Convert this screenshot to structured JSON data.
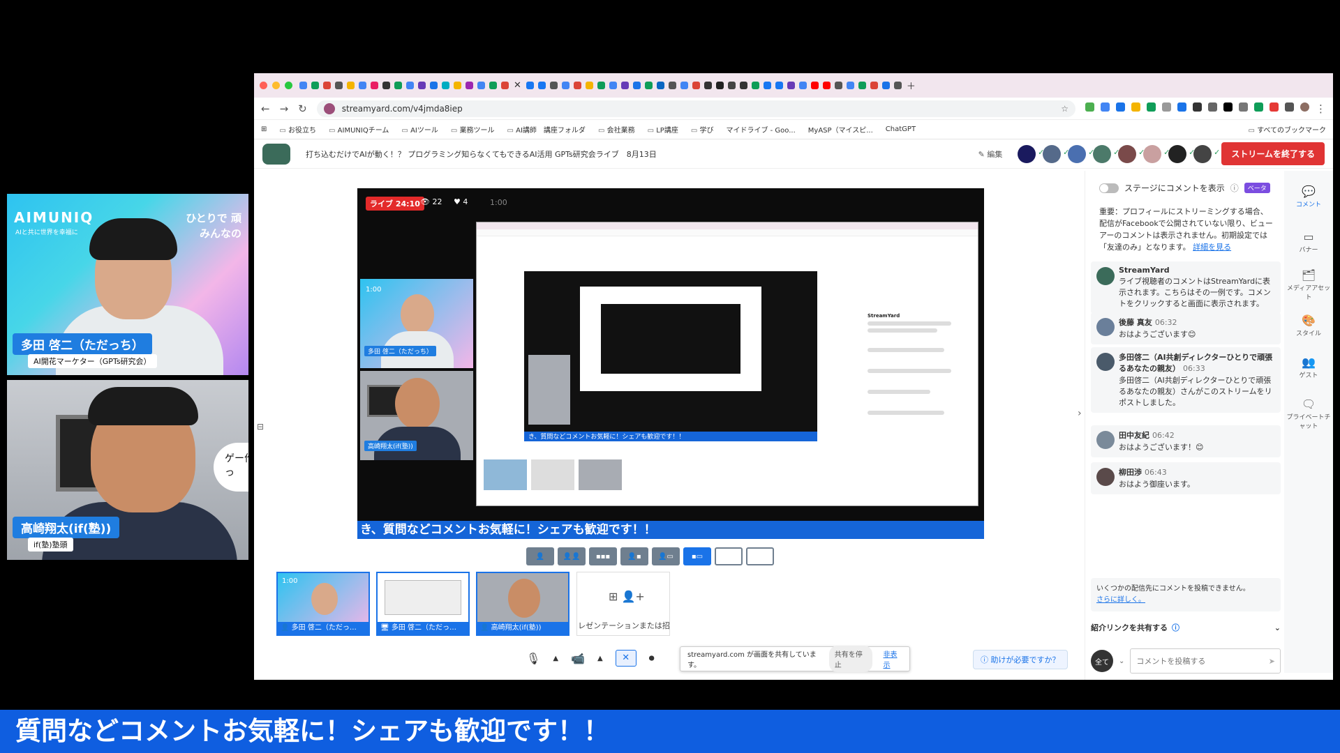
{
  "left_cams": {
    "cam1": {
      "logo": "AIMUNIQ",
      "logo_sub": "AIと共に世界を幸福に",
      "side_text_1": "ひとりで 頑",
      "side_text_2": "みんなの",
      "name": "多田 啓二（ただっち）",
      "title": "AI開花マーケター（GPTs研究会）"
    },
    "cam2": {
      "bubble": "ゲー作っ",
      "name": "高崎翔太(if(塾))",
      "title": "if(塾)塾頭"
    }
  },
  "browser": {
    "url": "streamyard.com/v4jmda8iep",
    "bookmarks": [
      "お役立ち",
      "AIMUNIQチーム",
      "AIツール",
      "業務ツール",
      "AI講師　講座フォルダ",
      "会社業務",
      "LP講座",
      "学び",
      "マイドライブ - Goo...",
      "MyASP（マイスピ...",
      "ChatGPT"
    ],
    "bookmarks_right": "すべてのブックマーク"
  },
  "streamyard": {
    "title": "打ち込むだけでAIが動く！？ プログラミング知らなくてもできるAI活用 GPTs研究会ライブ　8月13日",
    "edit_label": "編集",
    "end_stream": "ストリームを終了する",
    "live_badge": "ライブ 24:10",
    "viewers": "22",
    "reactions": "4",
    "stage_timer": "1:00",
    "stage_banner": "き、質問などコメントお気軽に！シェアも歓迎です！！",
    "inner_banner": "き、質問などコメントお気軽に！シェアも歓迎です！！",
    "inner_chat_name": "StreamYard",
    "mini_cam_1": "多田 啓二（ただっち）",
    "mini_cam_2": "高崎翔太(if(塾))",
    "mini_timer": "1:00",
    "thumbs": [
      "多田 啓二（ただっ…",
      "多田 啓二（ただっ…",
      "高崎翔太(if(塾))"
    ],
    "thumb_timer": "1:00",
    "add_label": "レゼンテーションまたは招",
    "share_text": "streamyard.com が画面を共有しています。",
    "share_stop": "共有を停止",
    "share_hide": "非表示",
    "help": "助けが必要ですか？"
  },
  "chat": {
    "toggle_label": "ステージにコメントを表示",
    "beta": "ベータ",
    "notice": "重要：プロフィールにストリーミングする場合、配信がFacebookで公開されていない限り、ビューアーのコメントは表示されません。初期設定では「友達のみ」となります。",
    "notice_link": "詳細を見る",
    "messages": [
      {
        "name": "StreamYard",
        "time": "",
        "text": "ライブ視聴者のコメントはStreamYardに表示されます。こちらはその一例です。コメントをクリックすると画面に表示されます。"
      },
      {
        "name": "後藤 真友",
        "time": "06:32",
        "text": "おはようございます😊"
      },
      {
        "name": "多田啓二（AI共創ディレクターひとりで頑張るあなたの親友）",
        "time": "06:33",
        "text": "多田啓二（AI共創ディレクターひとりで頑張るあなたの親友）さんがこのストリームをリポストしました。"
      },
      {
        "name": "田中友紀",
        "time": "06:42",
        "text": "おはようございます！😊"
      },
      {
        "name": "柳田渉",
        "time": "06:43",
        "text": "おはよう御座います。"
      }
    ],
    "warn": "いくつかの配信先にコメントを投稿できません。",
    "warn_link": "さらに詳しく。",
    "referral": "紹介リンクを共有する",
    "audience": "全て",
    "input_placeholder": "コメントを投稿する"
  },
  "rail": [
    "コメント",
    "バナー",
    "メディアアセット",
    "スタイル",
    "ゲスト",
    "プライベートチャット"
  ],
  "ticker": "質問などコメントお気軽に！シェアも歓迎です！！"
}
